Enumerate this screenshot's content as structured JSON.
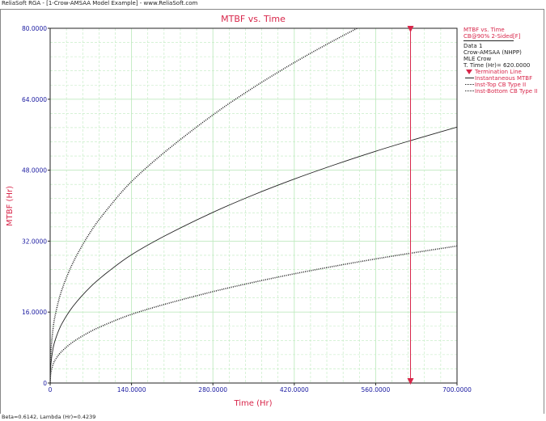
{
  "window": {
    "title": "ReliaSoft RGA - [1-Crow-AMSAA Model Example] - www.ReliaSoft.com",
    "status": "Beta=0.6142, Lambda (Hr)=0.4239"
  },
  "colors": {
    "accent": "#d8264a",
    "axis_tick_text": "#1a1aa0",
    "grid": "#bfeabf",
    "curve": "#222222",
    "termination": "#d8264a"
  },
  "legend": {
    "plot_name": "MTBF vs. Time",
    "cb_label": "CB@90% 2-Sided[F]",
    "data_name": "Data 1",
    "model": "Crow-AMSAA (NHPP)",
    "method": "MLE Crow",
    "t_time": "T. Time (Hr)= 620.0000",
    "entries": [
      {
        "label": "Termination Line",
        "style": "marker-down-triangle",
        "color": "#d8264a"
      },
      {
        "label": "Instantaneous MTBF",
        "style": "solid",
        "color": "#222222"
      },
      {
        "label": "Inst-Top CB Type II",
        "style": "dotted",
        "color": "#222222"
      },
      {
        "label": "Inst-Bottom CB Type II",
        "style": "dotted",
        "color": "#222222"
      }
    ]
  },
  "chart_data": {
    "type": "line",
    "title": "MTBF vs. Time",
    "xlabel": "Time (Hr)",
    "ylabel": "MTBF (Hr)",
    "xlim": [
      0,
      700
    ],
    "ylim": [
      0,
      80
    ],
    "x_ticks": [
      "0",
      "140.0000",
      "280.0000",
      "420.0000",
      "560.0000",
      "700.0000"
    ],
    "y_ticks": [
      "0",
      "16.0000",
      "32.0000",
      "48.0000",
      "64.0000",
      "80.0000"
    ],
    "grid": true,
    "legend_position": "right",
    "termination_x": 620,
    "series": [
      {
        "name": "Instantaneous MTBF",
        "style": "solid",
        "x": [
          0,
          1,
          5,
          10,
          20,
          40,
          70,
          100,
          140,
          200,
          280,
          350,
          420,
          490,
          560,
          620,
          700
        ],
        "y": [
          0,
          3.92,
          7.83,
          10.22,
          13.34,
          17.4,
          21.77,
          25.12,
          28.93,
          33.37,
          38.49,
          42.44,
          46.0,
          49.25,
          52.27,
          54.67,
          57.71
        ]
      },
      {
        "name": "Inst-Top CB Type II",
        "style": "dotted",
        "x": [
          0,
          1,
          5,
          10,
          20,
          40,
          70,
          100,
          140,
          200,
          280,
          350,
          420,
          490,
          560
        ],
        "y": [
          0,
          6.14,
          12.29,
          16.05,
          20.95,
          27.33,
          34.19,
          39.45,
          45.43,
          52.39,
          60.46,
          66.66,
          72.27,
          77.38,
          82.13
        ]
      },
      {
        "name": "Inst-Bottom CB Type II",
        "style": "dotted",
        "x": [
          0,
          1,
          5,
          10,
          20,
          40,
          70,
          100,
          140,
          200,
          280,
          350,
          420,
          490,
          560,
          620,
          700
        ],
        "y": [
          0,
          2.1,
          4.19,
          5.47,
          7.14,
          9.32,
          11.66,
          13.45,
          15.49,
          17.86,
          20.61,
          22.72,
          24.63,
          26.37,
          27.99,
          29.27,
          30.9
        ]
      }
    ]
  }
}
